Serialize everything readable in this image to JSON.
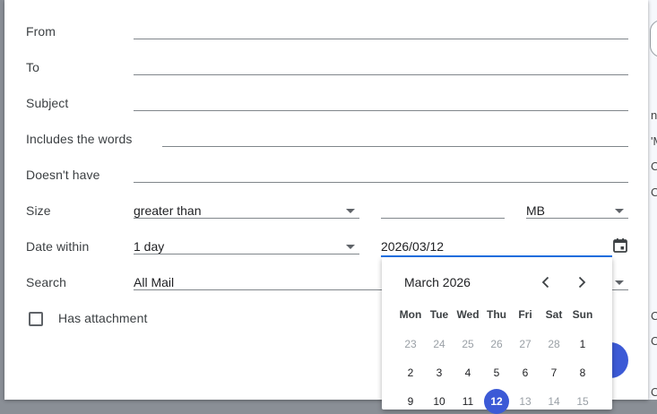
{
  "fields": {
    "from_label": "From",
    "to_label": "To",
    "subject_label": "Subject",
    "includes_label": "Includes the words",
    "doesnt_have_label": "Doesn't have",
    "size_label": "Size",
    "size_operator": "greater than",
    "size_unit": "MB",
    "date_within_label": "Date within",
    "date_within_value": "1 day",
    "date_value": "2026/03/12",
    "search_label": "Search",
    "search_value": "All Mail",
    "has_attachment_label": "Has attachment"
  },
  "calendar": {
    "title": "March 2026",
    "weekdays": [
      "Mon",
      "Tue",
      "Wed",
      "Thu",
      "Fri",
      "Sat",
      "Sun"
    ],
    "weeks": [
      [
        "23",
        "24",
        "25",
        "26",
        "27",
        "28",
        "1"
      ],
      [
        "2",
        "3",
        "4",
        "5",
        "6",
        "7",
        "8"
      ],
      [
        "9",
        "10",
        "11",
        "12",
        "13",
        "14",
        "15"
      ]
    ],
    "selected_day": "12"
  },
  "background_fragments": [
    "n",
    "'M",
    "C",
    "C",
    "Cc",
    "C",
    "C"
  ],
  "colors": {
    "accent": "#3c5ad6",
    "focus_line": "#1a73e8"
  }
}
